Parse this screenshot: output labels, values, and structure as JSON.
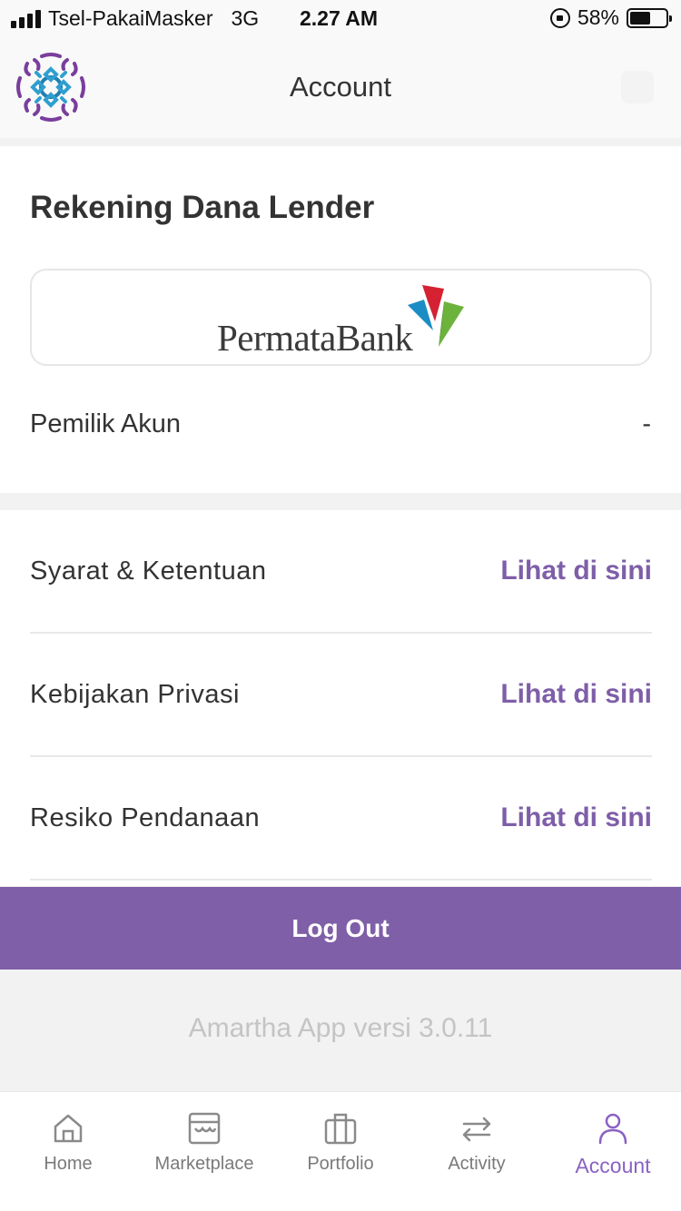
{
  "status_bar": {
    "carrier": "Tsel-PakaiMasker",
    "network": "3G",
    "time": "2.27 AM",
    "battery": "58%",
    "battery_level": 0.58
  },
  "header": {
    "title": "Account"
  },
  "bank_section": {
    "title": "Rekening Dana Lender",
    "bank_logo_text": "PermataBank",
    "owner_label": "Pemilik Akun",
    "owner_value": "-"
  },
  "links": [
    {
      "label": "Syarat & Ketentuan",
      "action": "Lihat di sini"
    },
    {
      "label": "Kebijakan Privasi",
      "action": "Lihat di sini"
    },
    {
      "label": "Resiko Pendanaan",
      "action": "Lihat di sini"
    }
  ],
  "logout_label": "Log Out",
  "version_text": "Amartha App versi 3.0.11",
  "tabs": [
    {
      "label": "Home",
      "icon": "home-icon"
    },
    {
      "label": "Marketplace",
      "icon": "marketplace-icon"
    },
    {
      "label": "Portfolio",
      "icon": "portfolio-icon"
    },
    {
      "label": "Activity",
      "icon": "activity-icon"
    },
    {
      "label": "Account",
      "icon": "account-icon",
      "active": true
    }
  ],
  "colors": {
    "accent": "#7f5fa7",
    "link": "#7e5ea8",
    "tab_active": "#8a62c2"
  }
}
